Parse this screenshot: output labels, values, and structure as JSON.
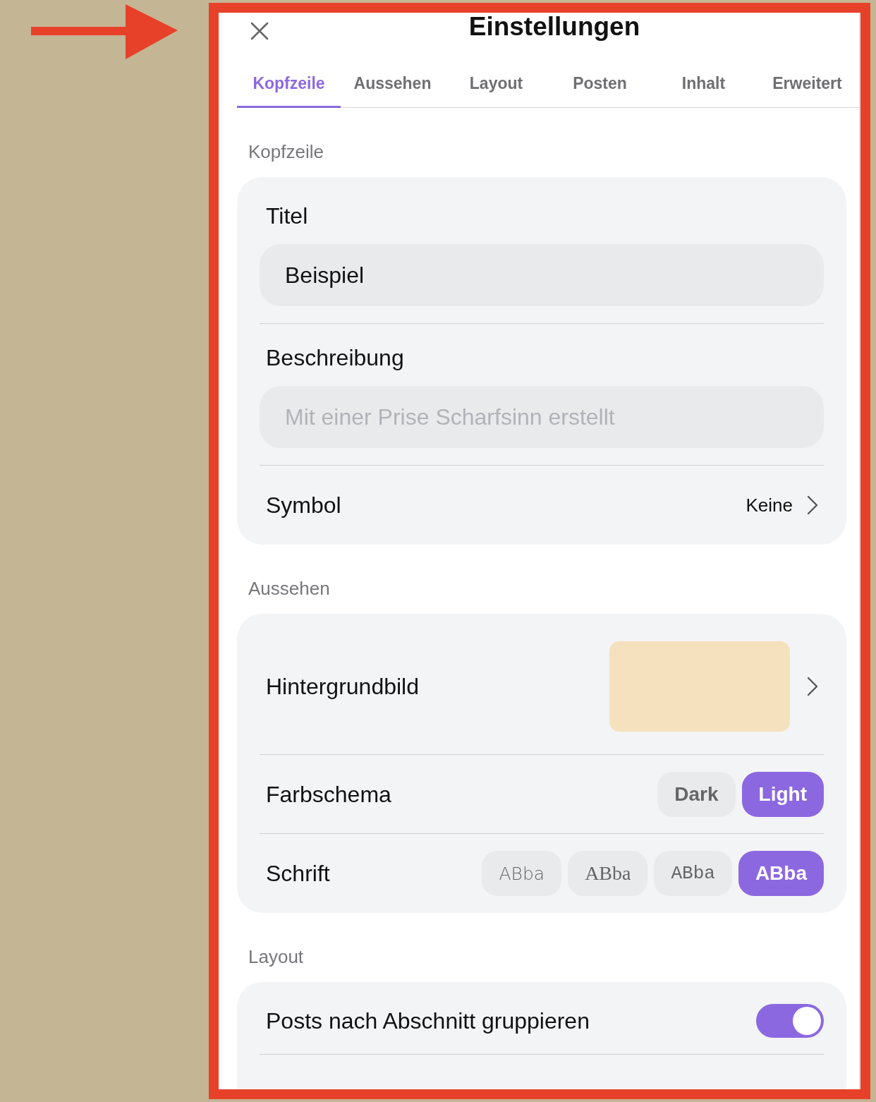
{
  "header": {
    "title": "Einstellungen"
  },
  "tabs": [
    {
      "label": "Kopfzeile",
      "selected": true
    },
    {
      "label": "Aussehen",
      "selected": false
    },
    {
      "label": "Layout",
      "selected": false
    },
    {
      "label": "Posten",
      "selected": false
    },
    {
      "label": "Inhalt",
      "selected": false
    },
    {
      "label": "Erweitert",
      "selected": false
    }
  ],
  "sections": [
    {
      "heading": "Kopfzeile",
      "rows": [
        {
          "kind": "field",
          "label": "Titel",
          "value": "Beispiel"
        },
        {
          "kind": "field",
          "label": "Beschreibung",
          "placeholder": "Mit einer Prise Scharfsinn erstellt"
        },
        {
          "kind": "link",
          "label": "Symbol",
          "value": "Keine"
        }
      ]
    },
    {
      "heading": "Aussehen",
      "rows": [
        {
          "kind": "image",
          "label": "Hintergrundbild"
        },
        {
          "kind": "choice",
          "label": "Farbschema",
          "options": [
            {
              "label": "Dark",
              "selected": false
            },
            {
              "label": "Light",
              "selected": true
            }
          ]
        },
        {
          "kind": "choice",
          "label": "Schrift",
          "options": [
            {
              "label": "ABba",
              "kind": "rounded",
              "selected": false
            },
            {
              "label": "ABba",
              "kind": "serif",
              "selected": false
            },
            {
              "label": "ABba",
              "kind": "mono",
              "selected": false
            },
            {
              "label": "ABba",
              "kind": "sans",
              "selected": true
            }
          ]
        }
      ]
    },
    {
      "heading": "Layout",
      "rows": [
        {
          "kind": "toggle",
          "label": "Posts nach Abschnitt gruppieren",
          "on": true
        }
      ]
    }
  ]
}
